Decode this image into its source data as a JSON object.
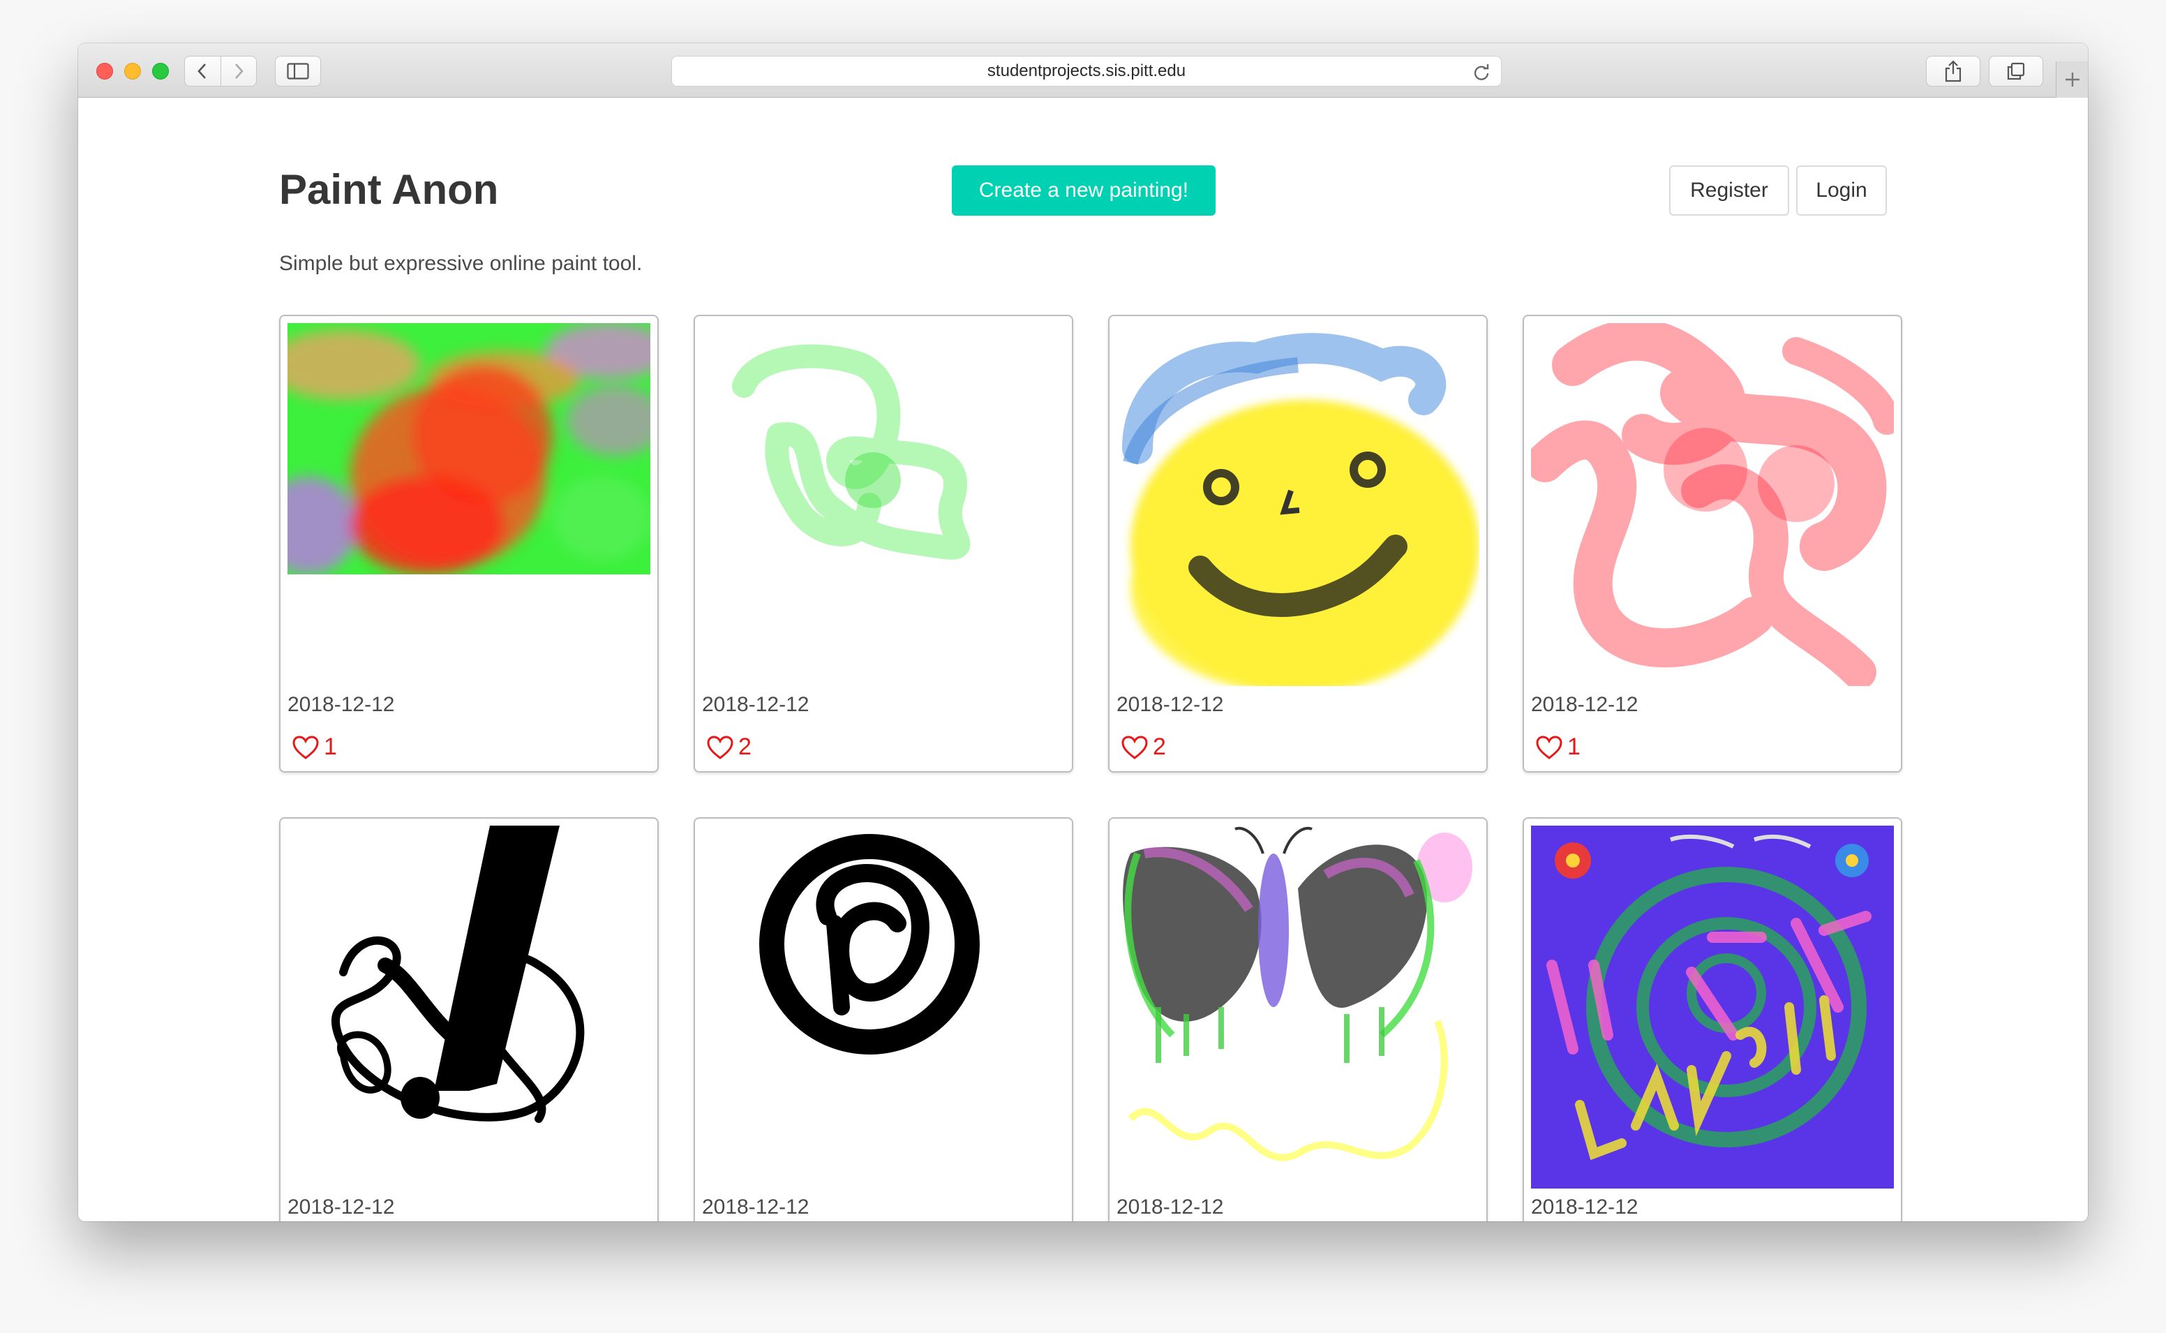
{
  "browser": {
    "url": "studentprojects.sis.pitt.edu"
  },
  "header": {
    "brand": "Paint Anon",
    "create_label": "Create a new painting!",
    "register_label": "Register",
    "login_label": "Login",
    "tagline": "Simple but expressive online paint tool.",
    "accent_color": "#00d1b2"
  },
  "paintings": [
    {
      "date": "2018-12-12",
      "likes": "1",
      "art": "multicolor-blur"
    },
    {
      "date": "2018-12-12",
      "likes": "2",
      "art": "green-squiggle"
    },
    {
      "date": "2018-12-12",
      "likes": "2",
      "art": "yellow-smiley-face"
    },
    {
      "date": "2018-12-12",
      "likes": "1",
      "art": "red-swirls"
    },
    {
      "date": "2018-12-12",
      "art": "black-brush-loops"
    },
    {
      "date": "2018-12-12",
      "art": "black-circles"
    },
    {
      "date": "2018-12-12",
      "art": "butterfly"
    },
    {
      "date": "2018-12-12",
      "art": "live-love-laugh"
    }
  ]
}
